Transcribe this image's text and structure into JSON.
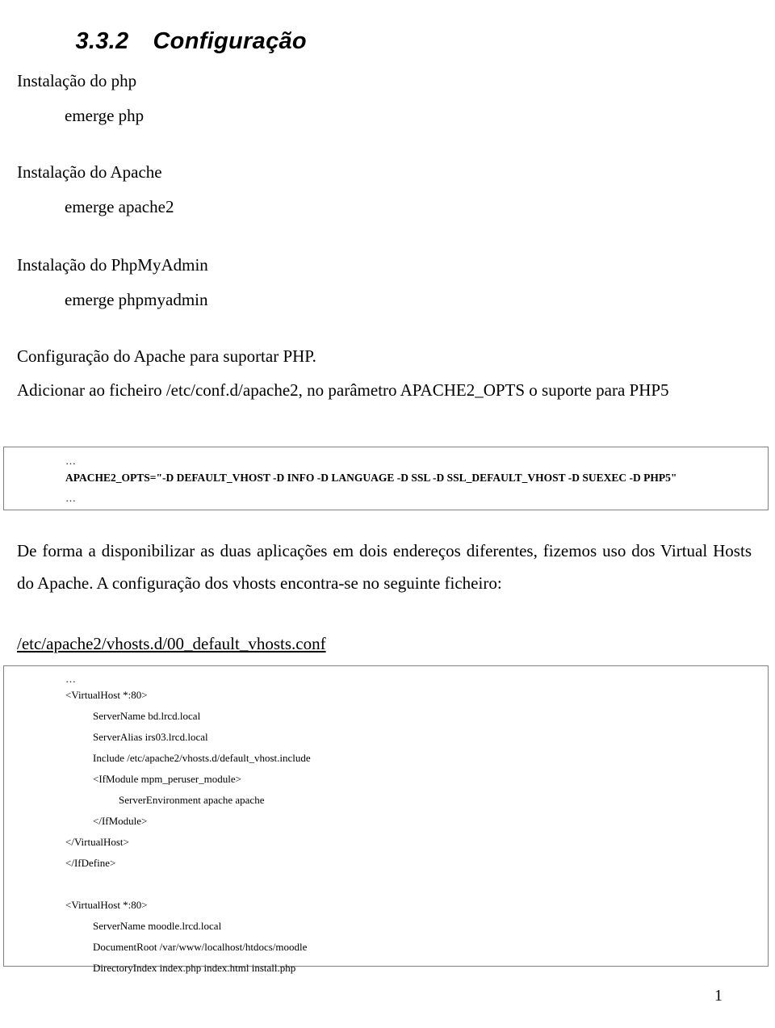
{
  "document": {
    "heading": {
      "number": "3.3.2",
      "title": "Configuração"
    },
    "blocks": [
      {
        "label": "Instalação do php",
        "command": "emerge php"
      },
      {
        "label": "Instalação do Apache",
        "command": "emerge apache2"
      },
      {
        "label": "Instalação do PhpMyAdmin",
        "command": "emerge phpmyadmin"
      }
    ],
    "config_intro": {
      "line1": "Configuração do Apache para suportar PHP.",
      "line2": "Adicionar ao ficheiro /etc/conf.d/apache2, no parâmetro APACHE2_OPTS o suporte para PHP5"
    },
    "code_block_1": {
      "lines": [
        {
          "text": "…",
          "indent": 0,
          "style": "dots"
        },
        {
          "text": "APACHE2_OPTS=\"-D DEFAULT_VHOST -D INFO -D LANGUAGE -D SSL -D SSL_DEFAULT_VHOST -D SUEXEC -D PHP5\"",
          "indent": 0,
          "style": "bold"
        },
        {
          "text": "…",
          "indent": 0,
          "style": "dots"
        }
      ]
    },
    "paragraph": "De forma a disponibilizar as duas aplicações em dois endereços diferentes, fizemos uso dos Virtual Hosts do Apache. A configuração dos vhosts encontra-se no seguinte ficheiro:",
    "file_path": "/etc/apache2/vhosts.d/00_default_vhosts.conf",
    "code_block_2": {
      "lines": [
        {
          "text": "…",
          "indent": 1,
          "style": "dots"
        },
        {
          "text": "<VirtualHost *:80>",
          "indent": 1,
          "style": "normal"
        },
        {
          "text": "ServerName bd.lrcd.local",
          "indent": 2,
          "style": "normal"
        },
        {
          "text": "ServerAlias irs03.lrcd.local",
          "indent": 2,
          "style": "normal"
        },
        {
          "text": "Include /etc/apache2/vhosts.d/default_vhost.include",
          "indent": 2,
          "style": "normal"
        },
        {
          "text": "<IfModule mpm_peruser_module>",
          "indent": 2,
          "style": "normal"
        },
        {
          "text": "ServerEnvironment apache apache",
          "indent": 3,
          "style": "normal"
        },
        {
          "text": "</IfModule>",
          "indent": 2,
          "style": "normal"
        },
        {
          "text": "</VirtualHost>",
          "indent": 1,
          "style": "normal"
        },
        {
          "text": "</IfDefine>",
          "indent": 1,
          "style": "normal"
        },
        {
          "text": "",
          "indent": 1,
          "style": "normal"
        },
        {
          "text": "<VirtualHost *:80>",
          "indent": 1,
          "style": "normal"
        },
        {
          "text": "ServerName moodle.lrcd.local",
          "indent": 2,
          "style": "normal"
        },
        {
          "text": "DocumentRoot /var/www/localhost/htdocs/moodle",
          "indent": 2,
          "style": "normal"
        },
        {
          "text": "DirectoryIndex index.php index.html install.php",
          "indent": 2,
          "style": "normal"
        }
      ]
    },
    "page_number": "1"
  }
}
